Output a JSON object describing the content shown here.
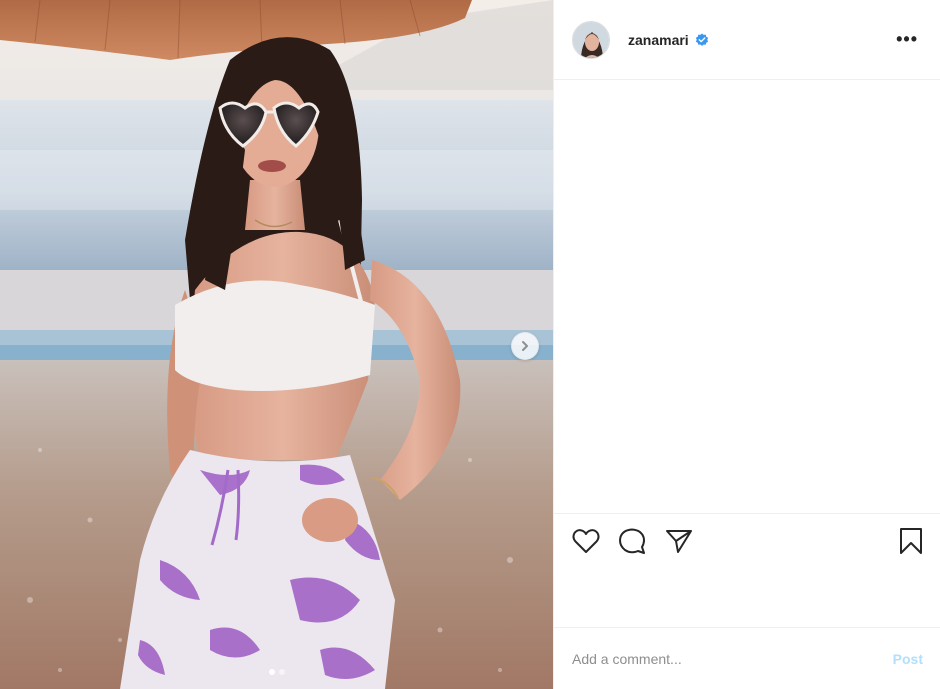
{
  "post": {
    "username": "zanamari",
    "verified": true,
    "more_label": "•••"
  },
  "media": {
    "description_icon": "photo",
    "carousel_total": 2,
    "carousel_active": 1,
    "next_icon": "chevron-right-icon"
  },
  "actions": {
    "like_icon": "heart-icon",
    "comment_icon": "comment-icon",
    "share_icon": "paper-plane-icon",
    "save_icon": "bookmark-icon"
  },
  "comment_box": {
    "placeholder": "Add a comment...",
    "post_label": "Post"
  },
  "colors": {
    "verified_blue": "#3897f0",
    "post_disabled": "#b2dffc",
    "text": "#262626",
    "muted": "#8e8e8e",
    "divider": "#efefef"
  }
}
